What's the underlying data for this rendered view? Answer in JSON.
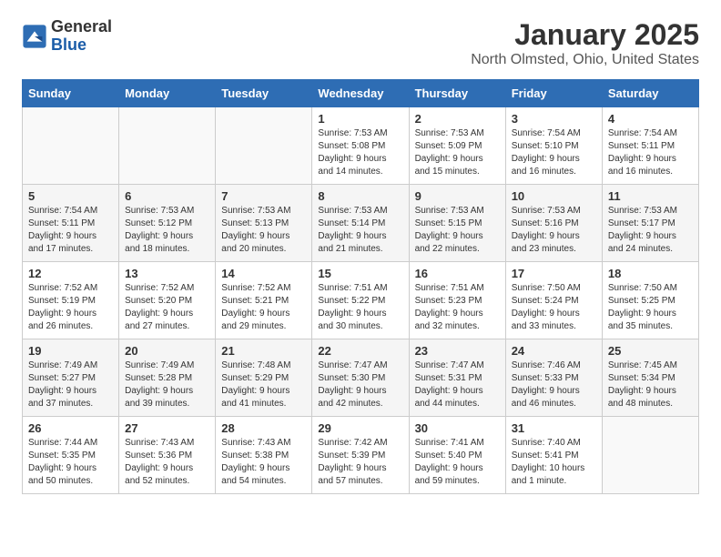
{
  "header": {
    "logo_line1": "General",
    "logo_line2": "Blue",
    "title": "January 2025",
    "subtitle": "North Olmsted, Ohio, United States"
  },
  "weekdays": [
    "Sunday",
    "Monday",
    "Tuesday",
    "Wednesday",
    "Thursday",
    "Friday",
    "Saturday"
  ],
  "weeks": [
    [
      {
        "day": "",
        "content": ""
      },
      {
        "day": "",
        "content": ""
      },
      {
        "day": "",
        "content": ""
      },
      {
        "day": "1",
        "content": "Sunrise: 7:53 AM\nSunset: 5:08 PM\nDaylight: 9 hours\nand 14 minutes."
      },
      {
        "day": "2",
        "content": "Sunrise: 7:53 AM\nSunset: 5:09 PM\nDaylight: 9 hours\nand 15 minutes."
      },
      {
        "day": "3",
        "content": "Sunrise: 7:54 AM\nSunset: 5:10 PM\nDaylight: 9 hours\nand 16 minutes."
      },
      {
        "day": "4",
        "content": "Sunrise: 7:54 AM\nSunset: 5:11 PM\nDaylight: 9 hours\nand 16 minutes."
      }
    ],
    [
      {
        "day": "5",
        "content": "Sunrise: 7:54 AM\nSunset: 5:11 PM\nDaylight: 9 hours\nand 17 minutes."
      },
      {
        "day": "6",
        "content": "Sunrise: 7:53 AM\nSunset: 5:12 PM\nDaylight: 9 hours\nand 18 minutes."
      },
      {
        "day": "7",
        "content": "Sunrise: 7:53 AM\nSunset: 5:13 PM\nDaylight: 9 hours\nand 20 minutes."
      },
      {
        "day": "8",
        "content": "Sunrise: 7:53 AM\nSunset: 5:14 PM\nDaylight: 9 hours\nand 21 minutes."
      },
      {
        "day": "9",
        "content": "Sunrise: 7:53 AM\nSunset: 5:15 PM\nDaylight: 9 hours\nand 22 minutes."
      },
      {
        "day": "10",
        "content": "Sunrise: 7:53 AM\nSunset: 5:16 PM\nDaylight: 9 hours\nand 23 minutes."
      },
      {
        "day": "11",
        "content": "Sunrise: 7:53 AM\nSunset: 5:17 PM\nDaylight: 9 hours\nand 24 minutes."
      }
    ],
    [
      {
        "day": "12",
        "content": "Sunrise: 7:52 AM\nSunset: 5:19 PM\nDaylight: 9 hours\nand 26 minutes."
      },
      {
        "day": "13",
        "content": "Sunrise: 7:52 AM\nSunset: 5:20 PM\nDaylight: 9 hours\nand 27 minutes."
      },
      {
        "day": "14",
        "content": "Sunrise: 7:52 AM\nSunset: 5:21 PM\nDaylight: 9 hours\nand 29 minutes."
      },
      {
        "day": "15",
        "content": "Sunrise: 7:51 AM\nSunset: 5:22 PM\nDaylight: 9 hours\nand 30 minutes."
      },
      {
        "day": "16",
        "content": "Sunrise: 7:51 AM\nSunset: 5:23 PM\nDaylight: 9 hours\nand 32 minutes."
      },
      {
        "day": "17",
        "content": "Sunrise: 7:50 AM\nSunset: 5:24 PM\nDaylight: 9 hours\nand 33 minutes."
      },
      {
        "day": "18",
        "content": "Sunrise: 7:50 AM\nSunset: 5:25 PM\nDaylight: 9 hours\nand 35 minutes."
      }
    ],
    [
      {
        "day": "19",
        "content": "Sunrise: 7:49 AM\nSunset: 5:27 PM\nDaylight: 9 hours\nand 37 minutes."
      },
      {
        "day": "20",
        "content": "Sunrise: 7:49 AM\nSunset: 5:28 PM\nDaylight: 9 hours\nand 39 minutes."
      },
      {
        "day": "21",
        "content": "Sunrise: 7:48 AM\nSunset: 5:29 PM\nDaylight: 9 hours\nand 41 minutes."
      },
      {
        "day": "22",
        "content": "Sunrise: 7:47 AM\nSunset: 5:30 PM\nDaylight: 9 hours\nand 42 minutes."
      },
      {
        "day": "23",
        "content": "Sunrise: 7:47 AM\nSunset: 5:31 PM\nDaylight: 9 hours\nand 44 minutes."
      },
      {
        "day": "24",
        "content": "Sunrise: 7:46 AM\nSunset: 5:33 PM\nDaylight: 9 hours\nand 46 minutes."
      },
      {
        "day": "25",
        "content": "Sunrise: 7:45 AM\nSunset: 5:34 PM\nDaylight: 9 hours\nand 48 minutes."
      }
    ],
    [
      {
        "day": "26",
        "content": "Sunrise: 7:44 AM\nSunset: 5:35 PM\nDaylight: 9 hours\nand 50 minutes."
      },
      {
        "day": "27",
        "content": "Sunrise: 7:43 AM\nSunset: 5:36 PM\nDaylight: 9 hours\nand 52 minutes."
      },
      {
        "day": "28",
        "content": "Sunrise: 7:43 AM\nSunset: 5:38 PM\nDaylight: 9 hours\nand 54 minutes."
      },
      {
        "day": "29",
        "content": "Sunrise: 7:42 AM\nSunset: 5:39 PM\nDaylight: 9 hours\nand 57 minutes."
      },
      {
        "day": "30",
        "content": "Sunrise: 7:41 AM\nSunset: 5:40 PM\nDaylight: 9 hours\nand 59 minutes."
      },
      {
        "day": "31",
        "content": "Sunrise: 7:40 AM\nSunset: 5:41 PM\nDaylight: 10 hours\nand 1 minute."
      },
      {
        "day": "",
        "content": ""
      }
    ]
  ]
}
